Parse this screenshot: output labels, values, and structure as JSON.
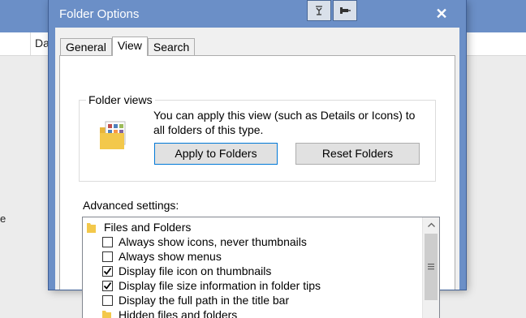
{
  "background": {
    "column_header": "Da"
  },
  "dialog": {
    "title": "Folder Options",
    "tabs": [
      {
        "label": "General"
      },
      {
        "label": "View"
      },
      {
        "label": "Search"
      }
    ],
    "folder_views": {
      "legend": "Folder views",
      "description": "You can apply this view (such as Details or Icons) to all folders of this type.",
      "apply_label": "Apply to Folders",
      "reset_label": "Reset Folders"
    },
    "advanced": {
      "label": "Advanced settings:",
      "items": [
        {
          "label": "Files and Folders",
          "type": "folder"
        },
        {
          "label": "Always show icons, never thumbnails",
          "type": "checkbox",
          "checked": false
        },
        {
          "label": "Always show menus",
          "type": "checkbox",
          "checked": false
        },
        {
          "label": "Display file icon on thumbnails",
          "type": "checkbox",
          "checked": true
        },
        {
          "label": "Display file size information in folder tips",
          "type": "checkbox",
          "checked": true
        },
        {
          "label": "Display the full path in the title bar",
          "type": "checkbox",
          "checked": false
        },
        {
          "label": "Hidden files and folders",
          "type": "folder"
        }
      ]
    }
  },
  "colors": {
    "titlebar": "#6b8fc7",
    "focus_border": "#0078d7",
    "folder_yellow": "#f3c84b"
  }
}
